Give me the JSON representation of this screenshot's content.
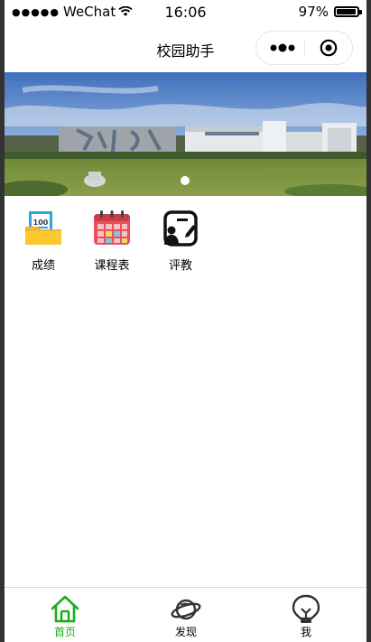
{
  "status_bar": {
    "signal_dots": "●●●●●",
    "carrier": "WeChat",
    "time": "16:06",
    "battery_percent": "97%",
    "battery_level": 0.97
  },
  "nav": {
    "title": "校园助手"
  },
  "banner": {
    "slide_count": 1,
    "active_index": 0
  },
  "grid": [
    {
      "label": "成绩",
      "icon": "score-folder-icon"
    },
    {
      "label": "课程表",
      "icon": "calendar-icon"
    },
    {
      "label": "评教",
      "icon": "evaluation-icon"
    }
  ],
  "tabs": [
    {
      "label": "首页",
      "icon": "home-icon",
      "active": true
    },
    {
      "label": "发现",
      "icon": "planet-icon",
      "active": false
    },
    {
      "label": "我",
      "icon": "lightbulb-icon",
      "active": false
    }
  ],
  "colors": {
    "tab_active": "#1aad19",
    "tab_inactive": "#000000",
    "frame_background": "#333333"
  }
}
